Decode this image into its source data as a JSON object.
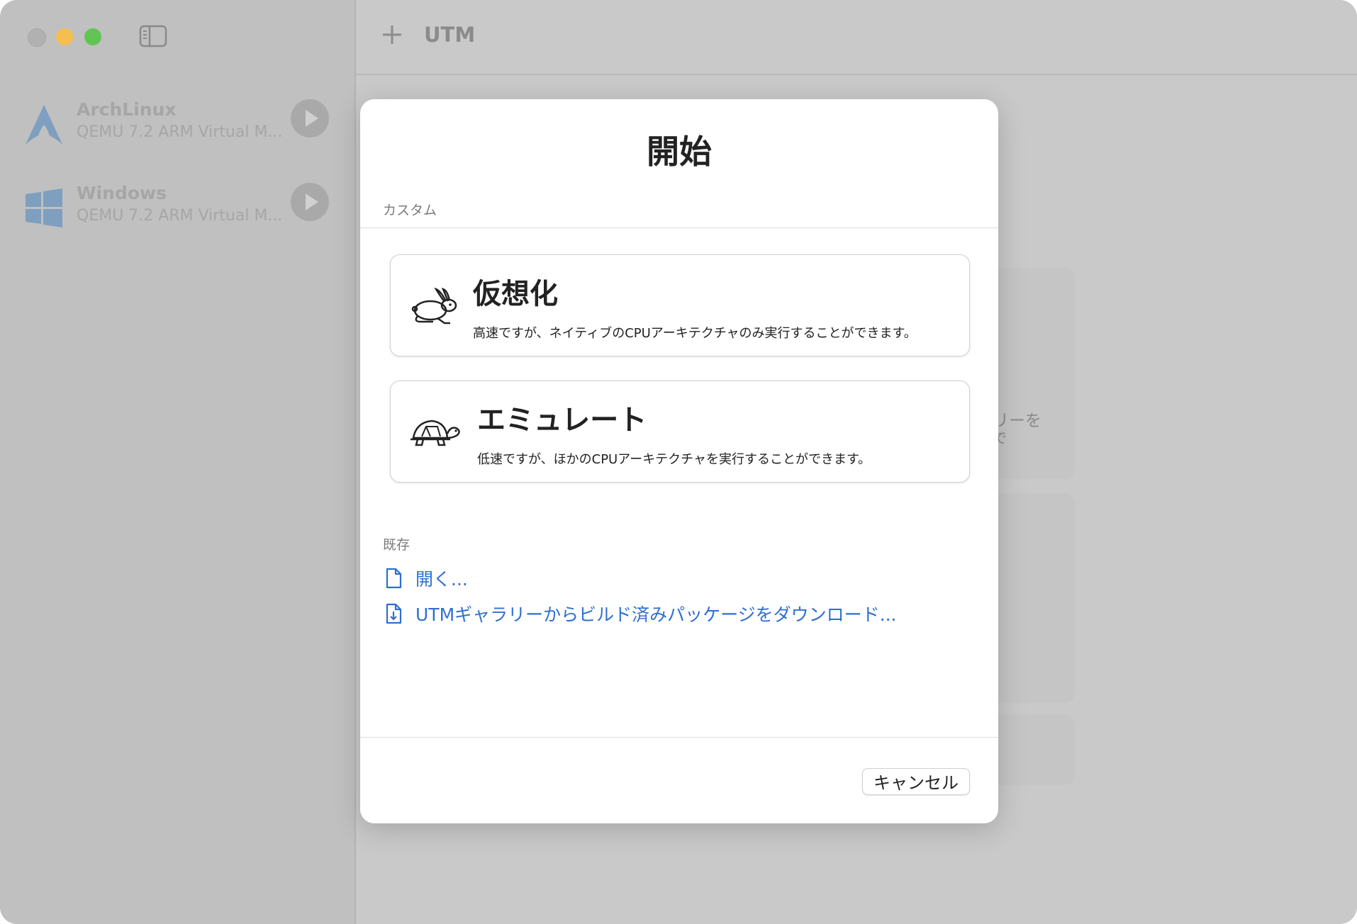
{
  "app": {
    "title": "UTM"
  },
  "sidebar": {
    "vms": [
      {
        "name": "ArchLinux",
        "subtitle": "QEMU 7.2 ARM Virtual M...",
        "logo": "arch-linux-logo"
      },
      {
        "name": "Windows",
        "subtitle": "QEMU 7.2 ARM Virtual M...",
        "logo": "windows-logo"
      }
    ]
  },
  "background": {
    "ghost_text_1": "リーを",
    "ghost_text_2": "で"
  },
  "modal": {
    "title": "開始",
    "custom_section_label": "カスタム",
    "options": [
      {
        "title": "仮想化",
        "description": "高速ですが、ネイティブのCPUアーキテクチャのみ実行することができます。",
        "icon": "rabbit-icon"
      },
      {
        "title": "エミュレート",
        "description": "低速ですが、ほかのCPUアーキテクチャを実行することができます。",
        "icon": "turtle-icon"
      }
    ],
    "existing_section_label": "既存",
    "links": [
      {
        "label": "開く...",
        "icon": "document-icon"
      },
      {
        "label": "UTMギャラリーからビルド済みパッケージをダウンロード...",
        "icon": "document-download-icon"
      }
    ],
    "cancel_label": "キャンセル"
  },
  "colors": {
    "accent": "#2f6fd1",
    "window_bg": "#c9c9c9",
    "traffic_min": "#f4bf4f",
    "traffic_max": "#61c554"
  }
}
